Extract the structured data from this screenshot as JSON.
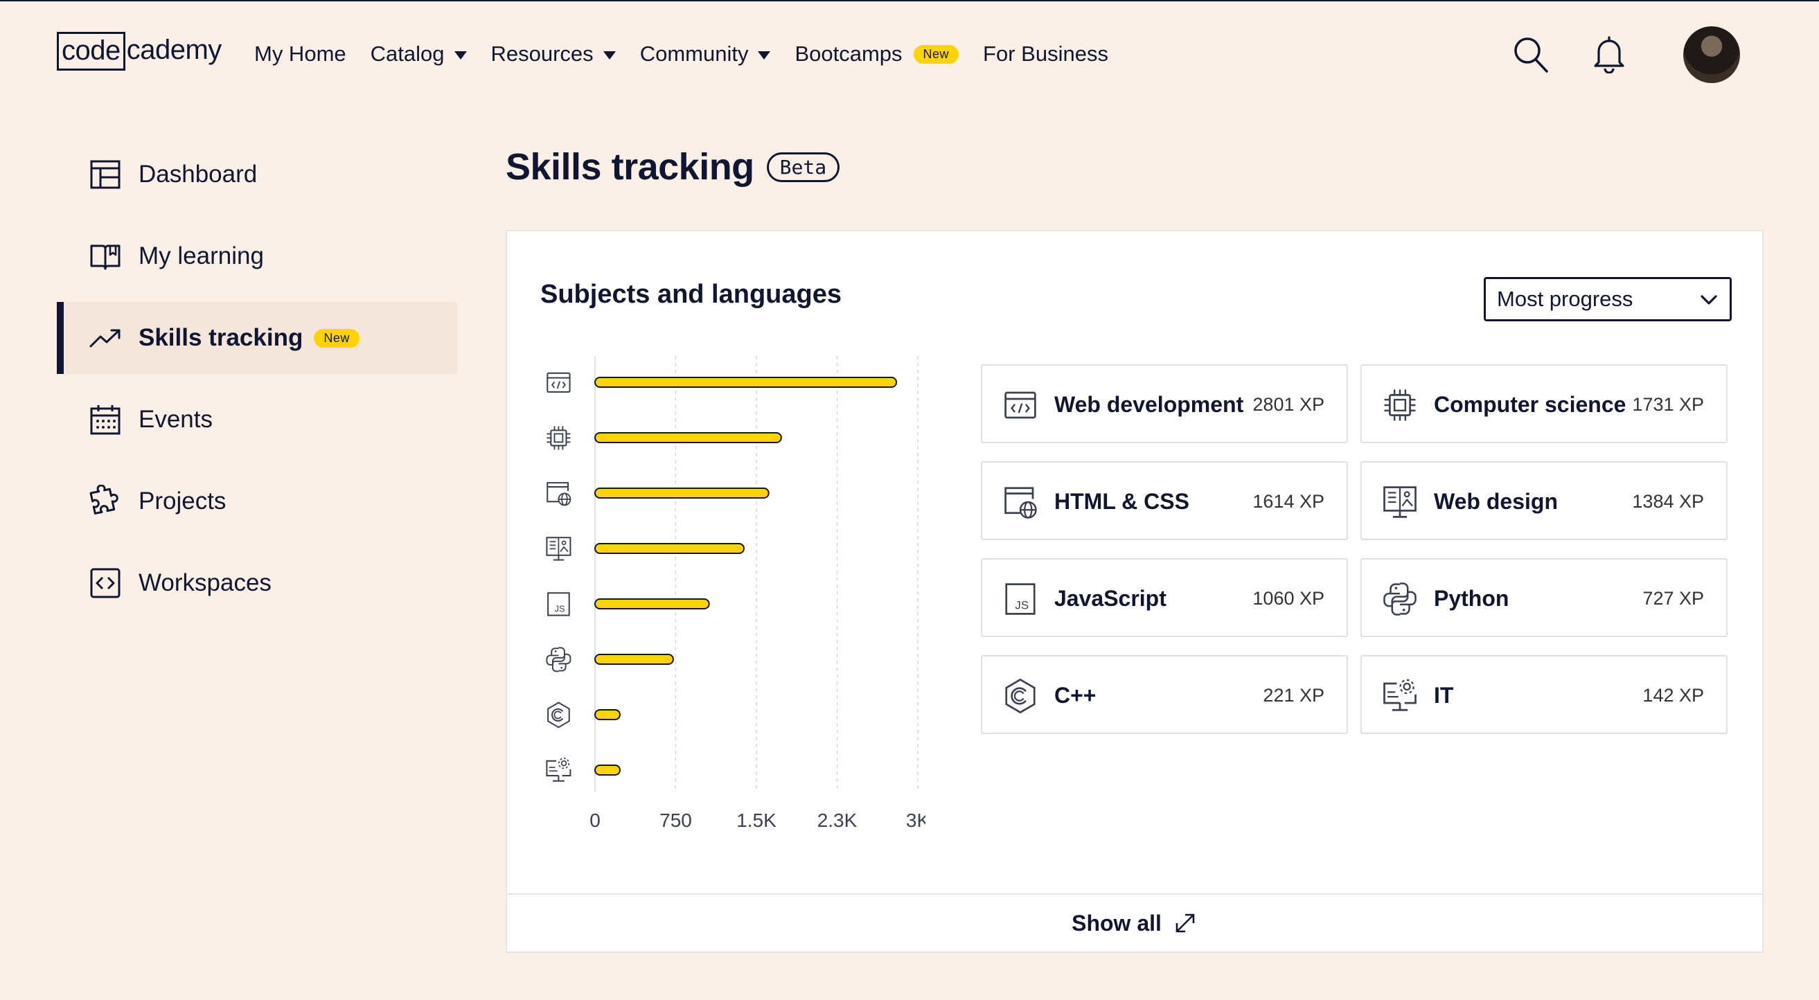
{
  "header": {
    "logo_box": "code",
    "logo_rest": "cademy",
    "nav": [
      {
        "label": "My Home"
      },
      {
        "label": "Catalog"
      },
      {
        "label": "Resources"
      },
      {
        "label": "Community"
      },
      {
        "label": "Bootcamps",
        "badge": "New"
      },
      {
        "label": "For Business"
      }
    ],
    "icons": [
      "search-icon",
      "bell-icon"
    ]
  },
  "sidebar": {
    "items": [
      {
        "label": "Dashboard",
        "icon": "layout-icon"
      },
      {
        "label": "My learning",
        "icon": "book-icon"
      },
      {
        "label": "Skills tracking",
        "icon": "trend-up-icon",
        "badge": "New",
        "active": true
      },
      {
        "label": "Events",
        "icon": "calendar-icon"
      },
      {
        "label": "Projects",
        "icon": "puzzle-icon"
      },
      {
        "label": "Workspaces",
        "icon": "code-brackets-icon"
      }
    ]
  },
  "main": {
    "title": "Skills tracking",
    "title_badge": "Beta",
    "card_title": "Subjects and languages",
    "sort_select": {
      "value": "Most progress"
    },
    "show_all": "Show all",
    "subjects": [
      {
        "name": "Web development",
        "xp": "2801 XP",
        "icon": "code-window-icon"
      },
      {
        "name": "Computer science",
        "xp": "1731 XP",
        "icon": "cpu-chip-icon"
      },
      {
        "name": "HTML & CSS",
        "xp": "1614 XP",
        "icon": "browser-globe-icon"
      },
      {
        "name": "Web design",
        "xp": "1384 XP",
        "icon": "monitor-design-icon"
      },
      {
        "name": "JavaScript",
        "xp": "1060 XP",
        "icon": "js-icon"
      },
      {
        "name": "Python",
        "xp": "727 XP",
        "icon": "python-icon"
      },
      {
        "name": "C++",
        "xp": "221 XP",
        "icon": "cplusplus-icon"
      },
      {
        "name": "IT",
        "xp": "142 XP",
        "icon": "monitor-gear-icon"
      }
    ]
  },
  "colors": {
    "background": "#fbf0e8",
    "bar": "#ffd300",
    "ink": "#10162f",
    "badge": "#ffd300"
  },
  "chart_data": {
    "type": "bar",
    "orientation": "horizontal",
    "categories": [
      "Web development",
      "Computer science",
      "HTML & CSS",
      "Web design",
      "JavaScript",
      "Python",
      "C++",
      "IT"
    ],
    "values": [
      2801,
      1731,
      1614,
      1384,
      1060,
      727,
      221,
      142
    ],
    "xlim": [
      0,
      3000
    ],
    "xticks": [
      0,
      750,
      1500,
      2250,
      3000
    ],
    "xtick_labels": [
      "0",
      "750",
      "1.5K",
      "2.3K",
      "3K"
    ],
    "grid": "vertical dashed",
    "legend": "none"
  }
}
